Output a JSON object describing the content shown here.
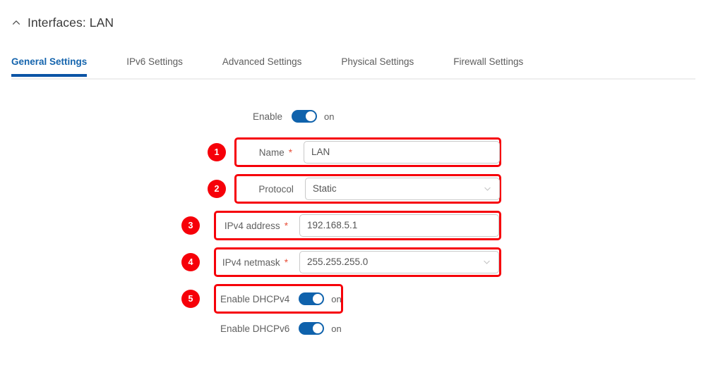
{
  "header": {
    "collapse_icon": "chevron-up-icon",
    "title": "Interfaces: LAN"
  },
  "tabs": [
    {
      "label": "General Settings",
      "active": true
    },
    {
      "label": "IPv6 Settings",
      "active": false
    },
    {
      "label": "Advanced Settings",
      "active": false
    },
    {
      "label": "Physical Settings",
      "active": false
    },
    {
      "label": "Firewall Settings",
      "active": false
    }
  ],
  "form": {
    "enable": {
      "label": "Enable",
      "state": "on"
    },
    "name": {
      "badge": "1",
      "label": "Name",
      "required": "*",
      "value": "LAN"
    },
    "protocol": {
      "badge": "2",
      "label": "Protocol",
      "value": "Static",
      "chevron": "chevron-down-icon"
    },
    "ipv4_address": {
      "badge": "3",
      "label": "IPv4 address",
      "required": "*",
      "value": "192.168.5.1"
    },
    "ipv4_netmask": {
      "badge": "4",
      "label": "IPv4 netmask",
      "required": "*",
      "value": "255.255.255.0",
      "chevron": "chevron-down-icon"
    },
    "dhcpv4": {
      "badge": "5",
      "label": "Enable DHCPv4",
      "state": "on"
    },
    "dhcpv6": {
      "label": "Enable DHCPv6",
      "state": "on"
    }
  },
  "colors": {
    "accent_blue": "#0b54a5",
    "tab_active_text": "#1464ad",
    "toggle_on": "#0f62ac",
    "highlight_red": "#f60009",
    "required_star": "#e8503a",
    "label_gray": "#616161"
  }
}
